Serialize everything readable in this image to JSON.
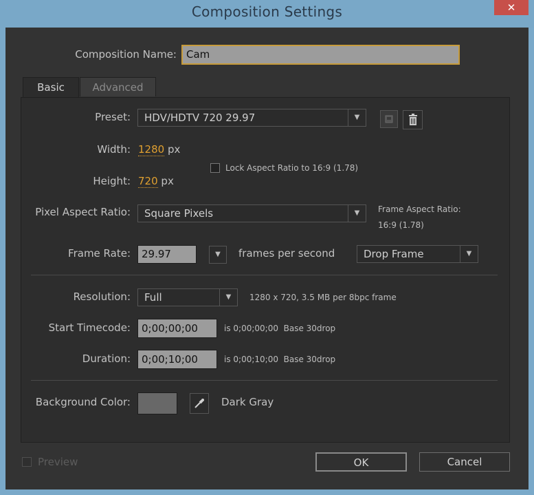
{
  "window": {
    "title": "Composition Settings",
    "close_glyph": "✕"
  },
  "composition_name": {
    "label": "Composition Name:",
    "value": "Cam"
  },
  "tabs": [
    {
      "label": "Basic",
      "active": true
    },
    {
      "label": "Advanced",
      "active": false
    }
  ],
  "preset": {
    "label": "Preset:",
    "value": "HDV/HDTV 720 29.97"
  },
  "width": {
    "label": "Width:",
    "value": "1280",
    "unit": "px"
  },
  "height": {
    "label": "Height:",
    "value": "720",
    "unit": "px"
  },
  "lock_aspect": {
    "label": "Lock Aspect Ratio to 16:9 (1.78)",
    "checked": false
  },
  "pixel_aspect": {
    "label": "Pixel Aspect Ratio:",
    "value": "Square Pixels"
  },
  "frame_aspect": {
    "label": "Frame Aspect Ratio:",
    "value": "16:9 (1.78)"
  },
  "frame_rate": {
    "label": "Frame Rate:",
    "value": "29.97",
    "unit_label": "frames per second",
    "drop_frame": "Drop Frame"
  },
  "resolution": {
    "label": "Resolution:",
    "value": "Full",
    "info": "1280 x 720, 3.5 MB per 8bpc frame"
  },
  "start_timecode": {
    "label": "Start Timecode:",
    "value": "0;00;00;00",
    "info": "is 0;00;00;00  Base 30drop"
  },
  "duration": {
    "label": "Duration:",
    "value": "0;00;10;00",
    "info": "is 0;00;10;00  Base 30drop"
  },
  "background": {
    "label": "Background Color:",
    "color_name": "Dark Gray",
    "color": "#686868"
  },
  "footer": {
    "preview_label": "Preview",
    "ok_label": "OK",
    "cancel_label": "Cancel"
  },
  "colors": {
    "accent": "#e0a030",
    "focus_border": "#c79b3a",
    "dialog_bg": "#333333",
    "titlebar": "#79a8c8"
  }
}
